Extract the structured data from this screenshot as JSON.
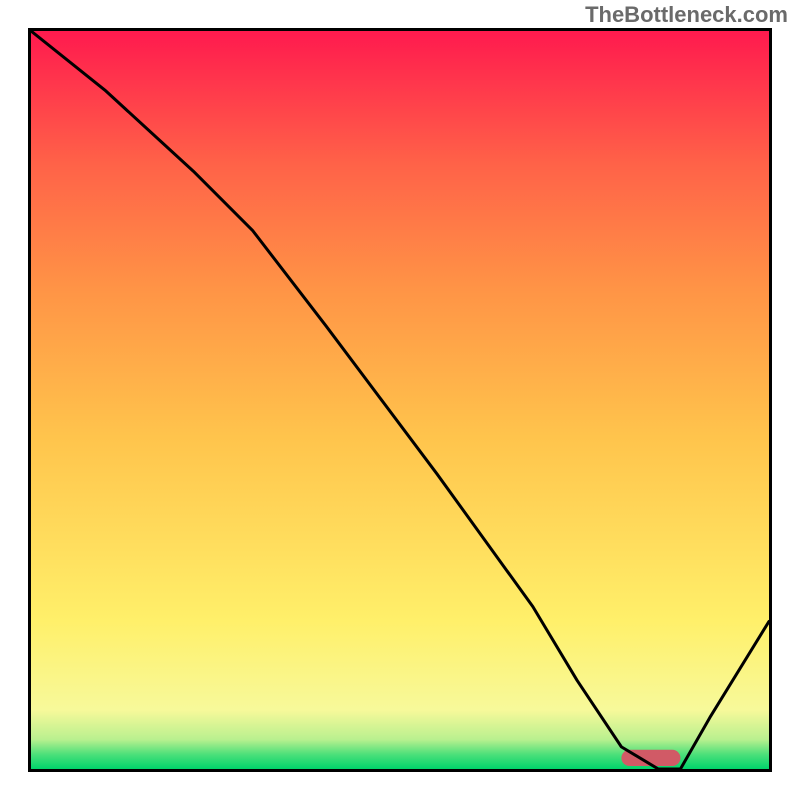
{
  "watermark": "TheBottleneck.com",
  "chart_data": {
    "type": "line",
    "title": "",
    "xlabel": "",
    "ylabel": "",
    "xlim": [
      0,
      100
    ],
    "ylim": [
      0,
      100
    ],
    "series": [
      {
        "name": "curve",
        "color": "#000000",
        "x": [
          0,
          10,
          22,
          30,
          40,
          55,
          68,
          74,
          80,
          85,
          88,
          92,
          100
        ],
        "values": [
          100,
          92,
          81,
          73,
          60,
          40,
          22,
          12,
          3,
          0,
          0,
          7,
          20
        ]
      }
    ],
    "marker": {
      "name": "optimal-range",
      "color": "#d15a66",
      "x_start": 80,
      "x_end": 88,
      "y": 1.5,
      "height": 2.2
    },
    "background_gradient": {
      "stops": [
        {
          "pos": 0.0,
          "color": "#00d36b"
        },
        {
          "pos": 0.02,
          "color": "#4de07a"
        },
        {
          "pos": 0.04,
          "color": "#b9f08f"
        },
        {
          "pos": 0.08,
          "color": "#f7f99a"
        },
        {
          "pos": 0.2,
          "color": "#fff06a"
        },
        {
          "pos": 0.45,
          "color": "#ffc44c"
        },
        {
          "pos": 0.65,
          "color": "#ff9446"
        },
        {
          "pos": 0.82,
          "color": "#ff6248"
        },
        {
          "pos": 1.0,
          "color": "#ff1a4e"
        }
      ]
    }
  }
}
